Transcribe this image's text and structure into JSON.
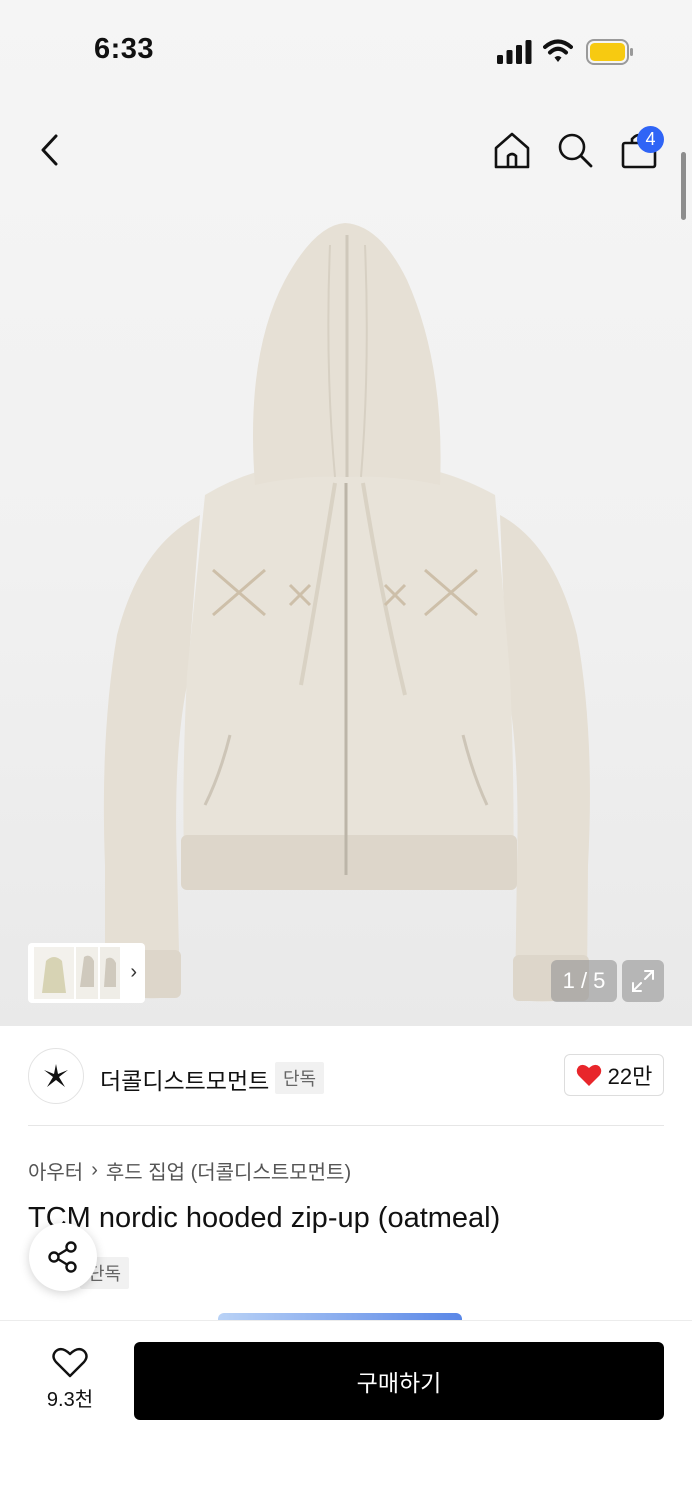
{
  "status_bar": {
    "time": "6:33"
  },
  "header": {
    "cart_count": "4"
  },
  "gallery": {
    "page_indicator": "1 / 5",
    "current_page": 1,
    "total_pages": 5
  },
  "brand": {
    "name": "더콜디스트모먼트",
    "tag": "단독",
    "likes": "22만"
  },
  "breadcrumb": {
    "category": "아우터",
    "separator": "›",
    "subcategory": "후드 집업 (더콜디스트모먼트)"
  },
  "product": {
    "title": "TCM nordic hooded zip-up (oatmeal)",
    "tag": "단독"
  },
  "bottom_bar": {
    "wish_count": "9.3천",
    "buy_label": "구매하기"
  },
  "icons": {
    "back": "chevron-left-icon",
    "home": "home-icon",
    "search": "search-icon",
    "cart": "bag-icon",
    "expand": "expand-icon",
    "share": "share-icon",
    "heart": "heart-icon"
  },
  "colors": {
    "badge_blue": "#2f64f6",
    "heart_red": "#e8262b",
    "battery_yellow": "#f7ca11",
    "buy_button": "#000000"
  }
}
